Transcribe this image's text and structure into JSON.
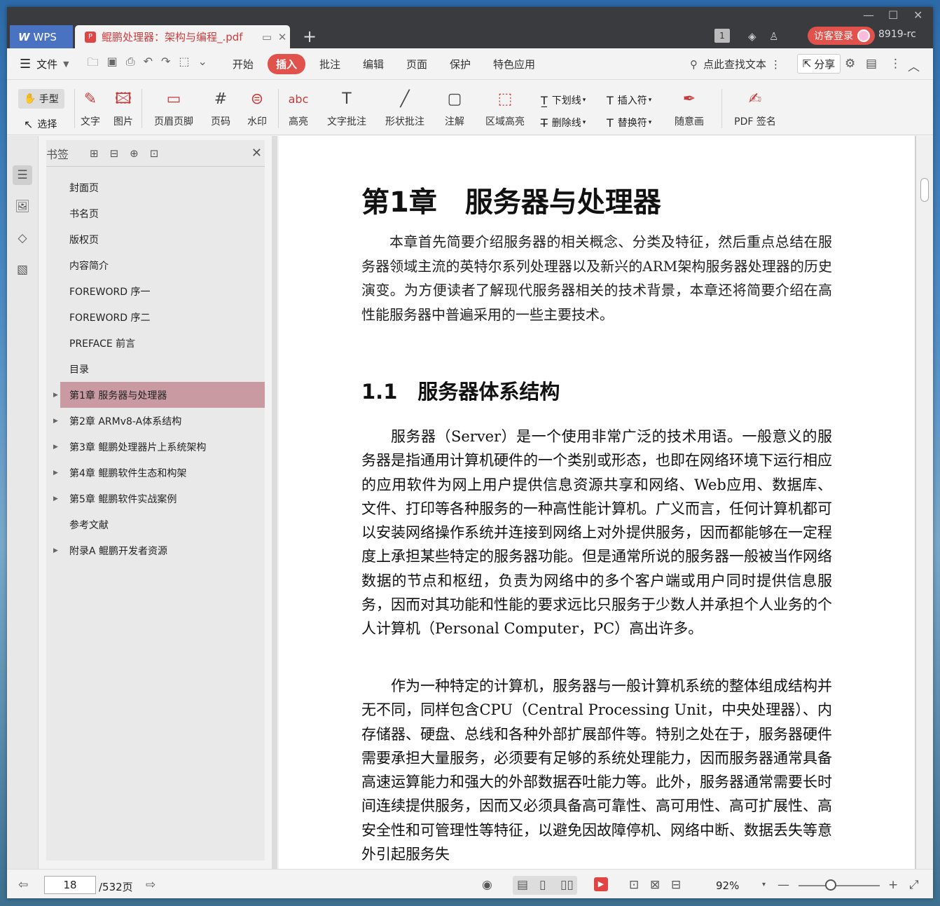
{
  "titlebar": {
    "wps_label": "WPS",
    "doc_tab_title": "鲲鹏处理器：架构与编程_.pdf",
    "login_label": "访客登录",
    "user_id": "8919-rc",
    "badge": "1"
  },
  "menubar": {
    "file_label": "文件",
    "tabs": [
      "开始",
      "插入",
      "批注",
      "编辑",
      "页面",
      "保护",
      "特色应用"
    ],
    "active_tab": "插入",
    "search_placeholder": "点此查找文本",
    "share_label": "分享"
  },
  "toolbar": {
    "hand_label": "手型",
    "select_label": "选择",
    "text_label": "文字",
    "image_label": "图片",
    "header_footer_label": "页眉页脚",
    "page_number_label": "页码",
    "watermark_label": "水印",
    "highlight_label": "高亮",
    "text_annot_label": "文字批注",
    "shape_annot_label": "形状批注",
    "note_label": "注解",
    "area_highlight_label": "区域高亮",
    "underline_label": "下划线",
    "strikethrough_label": "删除线",
    "insert_char_label": "插入符",
    "replace_char_label": "替换符",
    "freehand_label": "随意画",
    "pdf_sign_label": "PDF 签名"
  },
  "bookmarks": {
    "title": "书签",
    "items": [
      {
        "label": "封面页",
        "expandable": false
      },
      {
        "label": "书名页",
        "expandable": false
      },
      {
        "label": "版权页",
        "expandable": false
      },
      {
        "label": "内容简介",
        "expandable": false
      },
      {
        "label": "FOREWORD 序一",
        "expandable": false
      },
      {
        "label": "FOREWORD 序二",
        "expandable": false
      },
      {
        "label": "PREFACE 前言",
        "expandable": false
      },
      {
        "label": "目录",
        "expandable": false
      },
      {
        "label": "第1章 服务器与处理器",
        "expandable": true,
        "active": true
      },
      {
        "label": "第2章 ARMv8-A体系结构",
        "expandable": true
      },
      {
        "label": "第3章 鲲鹏处理器片上系统架构",
        "expandable": true
      },
      {
        "label": "第4章 鲲鹏软件生态和构架",
        "expandable": true
      },
      {
        "label": "第5章 鲲鹏软件实战案例",
        "expandable": true
      },
      {
        "label": "参考文献",
        "expandable": false
      },
      {
        "label": "附录A 鲲鹏开发者资源",
        "expandable": true
      }
    ]
  },
  "document": {
    "chapter_title": "第1章　服务器与处理器",
    "intro": "本章首先简要介绍服务器的相关概念、分类及特征，然后重点总结在服务器领域主流的英特尔系列处理器以及新兴的ARM架构服务器处理器的历史演变。为方便读者了解现代服务器相关的技术背景，本章还将简要介绍在高性能服务器中普遍采用的一些主要技术。",
    "section_title": "1.1　服务器体系结构",
    "para1": "服务器（Server）是一个使用非常广泛的技术用语。一般意义的服务器是指通用计算机硬件的一个类别或形态，也即在网络环境下运行相应的应用软件为网上用户提供信息资源共享和网络、Web应用、数据库、文件、打印等各种服务的一种高性能计算机。广义而言，任何计算机都可以安装网络操作系统并连接到网络上对外提供服务，因而都能够在一定程度上承担某些特定的服务器功能。但是通常所说的服务器一般被当作网络数据的节点和枢纽，负责为网络中的多个客户端或用户同时提供信息服务，因而对其功能和性能的要求远比只服务于少数人并承担个人业务的个人计算机（Personal Computer，PC）高出许多。",
    "para2": "作为一种特定的计算机，服务器与一般计算机系统的整体组成结构并无不同，同样包含CPU（Central Processing Unit，中央处理器）、内存储器、硬盘、总线和各种外部扩展部件等。特别之处在于，服务器硬件需要承担大量服务，必须要有足够的系统处理能力，因而服务器通常具备高速运算能力和强大的外部数据吞吐能力等。此外，服务器通常需要长时间连续提供服务，因而又必须具备高可靠性、高可用性、高可扩展性、高安全性和可管理性等特征，以避免因故障停机、网络中断、数据丢失等意外引起服务失"
  },
  "statusbar": {
    "current_page": "18",
    "total_pages": "/532页",
    "zoom": "92%",
    "zoom_fraction": 0.4
  }
}
